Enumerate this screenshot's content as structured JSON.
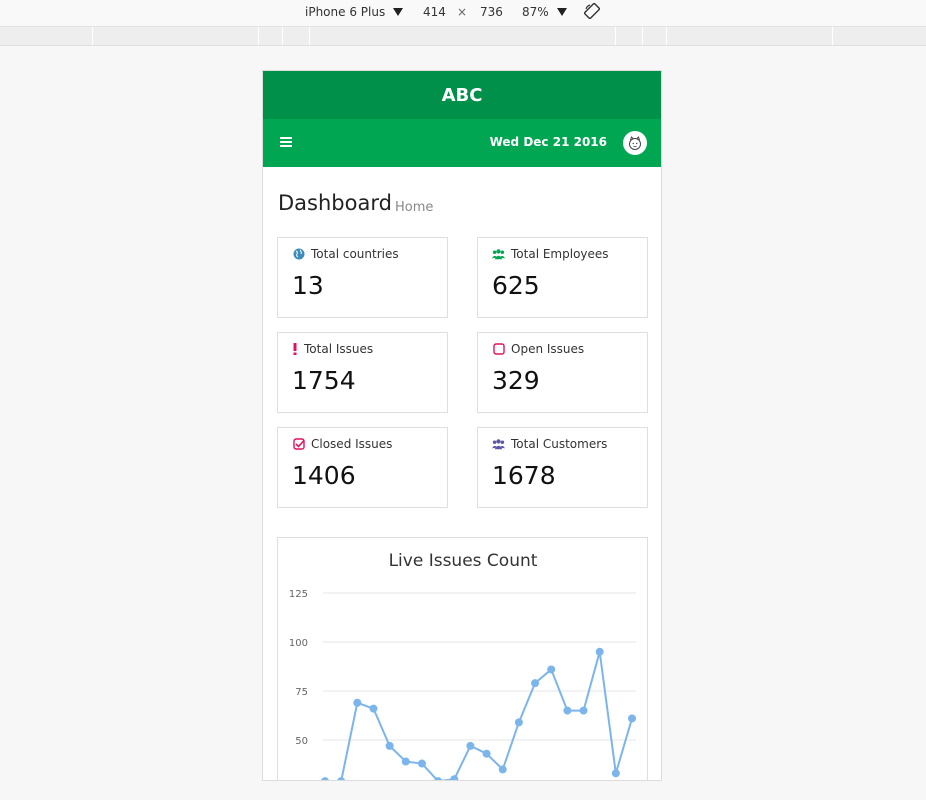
{
  "devtools": {
    "device": "iPhone 6 Plus",
    "width": "414",
    "separator": "×",
    "height": "736",
    "zoom": "87%",
    "device_dropdown_icon": "triangle-down",
    "zoom_dropdown_icon": "triangle-down",
    "rotate_icon": "rotate-icon"
  },
  "app": {
    "brand": "ABC",
    "date": "Wed Dec 21 2016"
  },
  "page": {
    "title": "Dashboard",
    "breadcrumb": "Home"
  },
  "stats": [
    {
      "label": "Total countries",
      "value": "13",
      "icon": "globe-icon",
      "color": "#3c8dbc"
    },
    {
      "label": "Total Employees",
      "value": "625",
      "icon": "users-icon",
      "color": "#00a651"
    },
    {
      "label": "Total Issues",
      "value": "1754",
      "icon": "exclamation-icon",
      "color": "#e0115f"
    },
    {
      "label": "Open Issues",
      "value": "329",
      "icon": "square-icon",
      "color": "#e0115f"
    },
    {
      "label": "Closed Issues",
      "value": "1406",
      "icon": "check-square-icon",
      "color": "#e0115f"
    },
    {
      "label": "Total Customers",
      "value": "1678",
      "icon": "users-icon",
      "color": "#5b57a6"
    }
  ],
  "chart_data": {
    "type": "line",
    "title": "Live Issues Count",
    "xlabel": "",
    "ylabel": "",
    "ylim": [
      25,
      125
    ],
    "yticks": [
      125,
      100,
      75,
      50
    ],
    "grid": true,
    "color": "#7cb5ec",
    "x": [
      1,
      2,
      3,
      4,
      5,
      6,
      7,
      8,
      9,
      10,
      11,
      12,
      13,
      14,
      15,
      16,
      17,
      18,
      19,
      20
    ],
    "values": [
      29,
      29,
      69,
      66,
      47,
      39,
      38,
      29,
      30,
      47,
      43,
      35,
      59,
      79,
      86,
      65,
      65,
      95,
      33,
      61
    ]
  }
}
